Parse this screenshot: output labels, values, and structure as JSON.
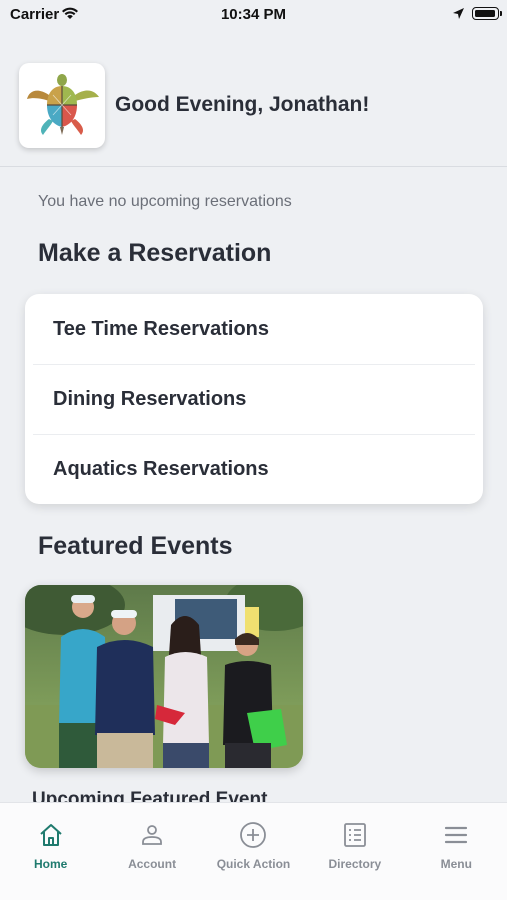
{
  "status_bar": {
    "carrier": "Carrier",
    "time": "10:34 PM"
  },
  "header": {
    "greeting": "Good Evening, Jonathan!",
    "logo_icon": "sea-turtle-logo"
  },
  "reservations": {
    "empty_message": "You have no upcoming reservations",
    "section_title": "Make a Reservation",
    "items": [
      {
        "label": "Tee Time Reservations"
      },
      {
        "label": "Dining Reservations"
      },
      {
        "label": "Aquatics Reservations"
      }
    ]
  },
  "featured": {
    "section_title": "Featured Events",
    "event_caption": "Upcoming Featured Event"
  },
  "tabbar": {
    "accent": "#1f7a6e",
    "items": [
      {
        "label": "Home",
        "icon": "home-icon",
        "active": true
      },
      {
        "label": "Account",
        "icon": "person-icon",
        "active": false
      },
      {
        "label": "Quick Action",
        "icon": "plus-circle-icon",
        "active": false
      },
      {
        "label": "Directory",
        "icon": "list-icon",
        "active": false
      },
      {
        "label": "Menu",
        "icon": "hamburger-icon",
        "active": false
      }
    ]
  }
}
